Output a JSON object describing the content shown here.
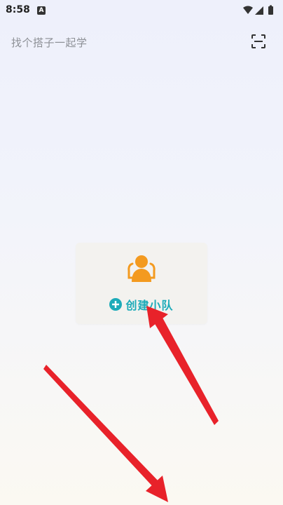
{
  "status_bar": {
    "time": "8:58",
    "app_icon_letter": "A",
    "icons": [
      "wifi-icon",
      "signal-icon",
      "battery-icon"
    ]
  },
  "header": {
    "title": "找个搭子一起学",
    "scan_icon": "scan-icon"
  },
  "team_card": {
    "icon": "group-people-icon",
    "create_label": "创建小队",
    "plus_icon": "plus-circle-icon"
  },
  "colors": {
    "accent": "#1dabb9",
    "icon_orange": "#f39a1f",
    "arrow_red": "#e8222a",
    "title_gray": "#8d9096"
  }
}
